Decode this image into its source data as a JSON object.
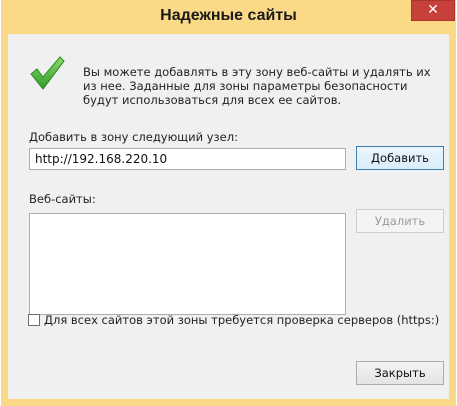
{
  "window": {
    "title": "Надежные сайты",
    "close_glyph": "✕"
  },
  "info": {
    "text": "Вы можете добавлять в эту зону  веб-сайты и удалять их из нее. Заданные для зоны параметры безопасности будут использоваться для всех ее сайтов.",
    "icon": "green-checkmark-icon"
  },
  "add_site": {
    "label": "Добавить в зону следующий узел:",
    "value": "http://192.168.220.10",
    "add_button": "Добавить"
  },
  "websites": {
    "label": "Веб-сайты:",
    "items": [],
    "remove_button": "Удалить"
  },
  "https_check": {
    "label": "Для всех сайтов этой зоны требуется проверка серверов (https:)",
    "checked": false
  },
  "footer": {
    "close_button": "Закрыть"
  },
  "colors": {
    "frame": "#fbd986",
    "close": "#c7413a",
    "check": "#3aa935"
  }
}
